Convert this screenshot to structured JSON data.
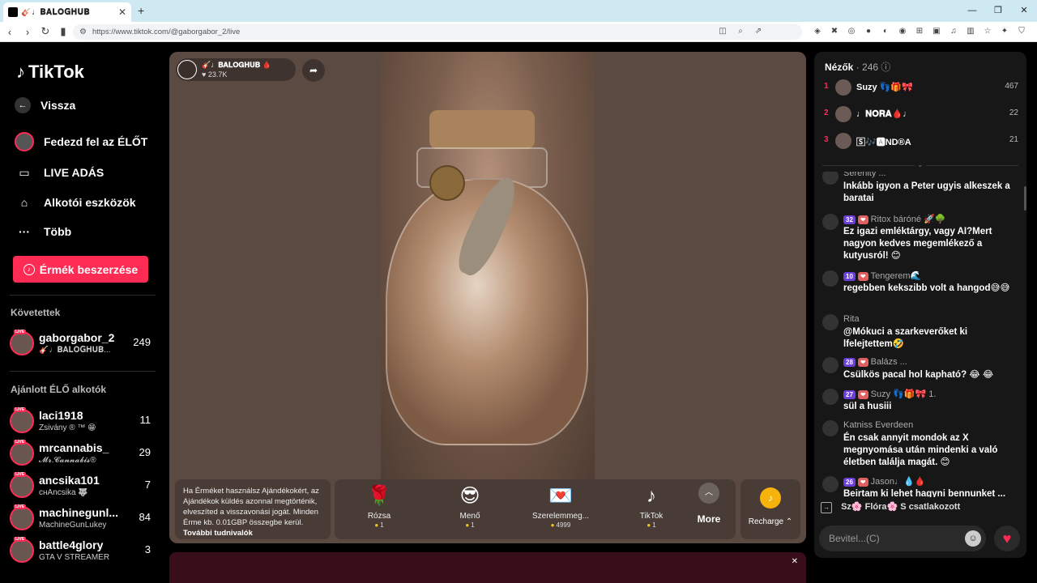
{
  "browser": {
    "tab_title": "🎸♩𝐁𝐀𝐋𝐎𝐆𝐇𝐔𝐁",
    "url": "https://www.tiktok.com/@gaborgabor_2/live"
  },
  "sidebar": {
    "logo": "TikTok",
    "back": "Vissza",
    "explore": "Fedezd fel az ÉLŐT",
    "live": "LIVE ADÁS",
    "creator_tools": "Alkotói eszközök",
    "more": "Több",
    "buy_coins": "Érmék beszerzése",
    "following_title": "Követettek",
    "following": [
      {
        "name": "gaborgabor_2",
        "sub": "🎸♩𝐁𝐀𝐋𝐎𝐆𝐇𝐔𝐁...",
        "count": "249"
      }
    ],
    "recommended_title": "Ajánlott ÉLŐ alkotók",
    "recommended": [
      {
        "name": "laci1918",
        "sub": "Zsivány ® ™ 😁",
        "count": "11"
      },
      {
        "name": "mrcannabis_",
        "sub": "𝓜𝓻.𝓒𝓪𝓷𝓷𝓪𝓫𝓲𝓼®",
        "count": "29"
      },
      {
        "name": "ancsika101",
        "sub": "ᴄʜAncsika 🐺",
        "count": "7"
      },
      {
        "name": "machinegunl...",
        "sub": "MachineGunLukey",
        "count": "84"
      },
      {
        "name": "battle4glory",
        "sub": "GTA V STREAMER",
        "count": "3"
      }
    ]
  },
  "stream": {
    "host_name": "🎸♩𝐁𝐀𝐋𝐎𝐆𝐇𝐔𝐁 🩸",
    "likes": "♥ 23.7K",
    "notice": "Ha Érméket használsz Ajándékokért, az Ajándékok küldés azonnal megtörténik, elveszíted a visszavonási jogát. Minden Érme kb. 0.01GBP összegbe kerül.",
    "notice_link": "További tudnivalók",
    "gifts": [
      {
        "icon": "🌹",
        "name": "Rózsa",
        "price": "1"
      },
      {
        "icon": "😎",
        "name": "Menő",
        "price": "1"
      },
      {
        "icon": "💌",
        "name": "Szerelemmeg...",
        "price": "4999"
      },
      {
        "icon": "♪",
        "name": "TikTok",
        "price": "1"
      }
    ],
    "more": "More",
    "recharge": "Recharge ⌃"
  },
  "chat": {
    "viewers_label": "Nézők",
    "viewers_count": "· 246",
    "top_viewers": [
      {
        "rank": "1",
        "name": "Suzy 👣🎁🎀",
        "score": "467"
      },
      {
        "rank": "2",
        "name": "♩𝐍𝐎𝐑𝐀🩸♩",
        "score": "22"
      },
      {
        "rank": "3",
        "name": "🅂🎶🅰ND®A",
        "score": "21"
      }
    ],
    "messages": [
      {
        "badge": "",
        "name": "Serenity ...",
        "text": "Inkább igyon a Peter ugyis alkeszek a baratai"
      },
      {
        "badge": "32",
        "name": "Ritox báróné 🚀🌳",
        "text": "Ez igazi emléktárgy, vagy AI?Mert nagyon kedves megemlékező a kutyusról! 😊"
      },
      {
        "badge": "10",
        "name": "Tengerem🌊",
        "text": "regebben kekszibb volt a hangod😅😅"
      },
      {
        "badge": "",
        "name": "Rita",
        "text": "@Mókuci a szarkeverőket ki lfelejtettem🤣"
      },
      {
        "badge": "28",
        "name": "Balázs ...",
        "text": "Csülkös pacal hol kapható? 😂 😂"
      },
      {
        "badge": "27",
        "name": "Suzy 👣🎁🎀 1.",
        "text": "sül a husiii"
      },
      {
        "badge": "",
        "name": "Katniss Everdeen",
        "text": "Én csak annyit mondok az X megnyomása után mindenki a való életben találja magát. 😊"
      },
      {
        "badge": "26",
        "name": "Jason♩💧🩸",
        "text": "Beirtam ki lehet hagyni bennunket ..."
      }
    ],
    "joined": "Sz🌸 Flóra🌸 S  csatlakozott",
    "input_placeholder": "Bevitel...(C)"
  }
}
